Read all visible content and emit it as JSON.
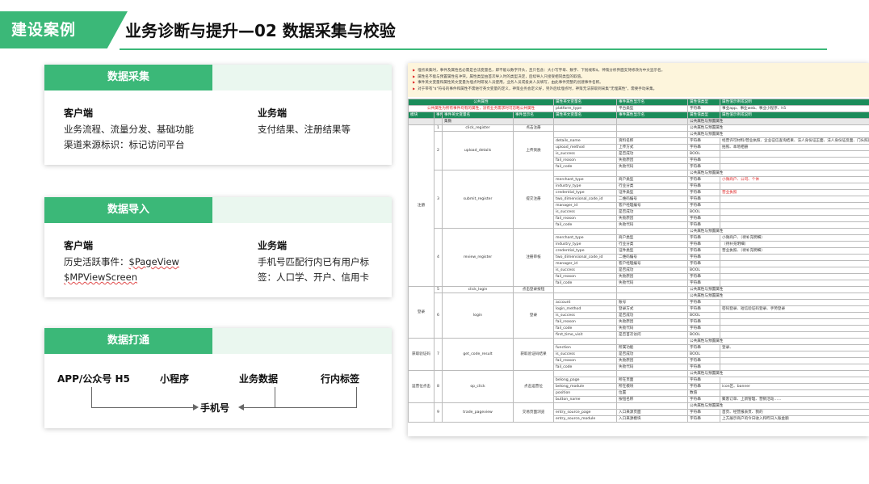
{
  "header": {
    "tag": "建设案例",
    "title": "业务诊断与提升—02 数据采集与校验"
  },
  "cards": {
    "collect": {
      "title": "数据采集",
      "left_title": "客户端",
      "left_lines": [
        "业务流程、流量分发、基础功能",
        "渠道来源标识：标记访问平台"
      ],
      "right_title": "业务端",
      "right_lines": [
        "支付结果、注册结果等"
      ]
    },
    "import": {
      "title": "数据导入",
      "left_title": "客户端",
      "left_line1_prefix": "历史活跃事件：",
      "left_line1_code": "$PageView",
      "left_line2_code": "$MPViewScreen",
      "right_title": "业务端",
      "right_lines": [
        "手机号匹配行内已有用户标",
        "签：人口学、开户、信用卡"
      ]
    },
    "connect": {
      "title": "数据打通",
      "items": [
        "APP/公众号 H5",
        "小程序",
        "业务数据",
        "行内标签"
      ],
      "target": "手机号"
    }
  },
  "sheet": {
    "notes": [
      "埋点采集时，事件及属性名必需是合法变量名，即不能以数字开头，且只包含：大小写字母、数字、下划线和$，神策分析界面支持修改为中文显示名。",
      "属性名不能与预置属性名冲突，属性类型由首次导入时的类型决定，后续导入只接受相同类型的取值。",
      "事件英文变量和属性英文变量为埋点时研发人员使用，业务人员或投关人员填写，由此事件完整的创建事件名称。",
      "对于带有\"$\"符号的事件和属性不需进行英文变量的定义，神策业务会定义好，另外后续埋点时，神策无法获取到采集\"无埋属性\"，需要手动采集。"
    ],
    "header1": [
      "公共属性",
      "属性英文变量名",
      "事件属性显示名",
      "属性值类型",
      "属性值示例或说明"
    ],
    "pub_note": "公共属性为所有事件均有的属性，没有业务需求时可忽略公共属性",
    "pub_row": [
      "platform_type",
      "平台类型",
      "字符串",
      "事业app、事业web、事业小程序、h5"
    ],
    "header2": [
      "模块",
      "事件",
      "事件英文变量名",
      "事件显示名",
      "属性英文变量名",
      "事件属性显示名",
      "属性值类型",
      "属性值示例或说明"
    ],
    "sub_header": "集数",
    "pub_label": "公共属性与预置属性",
    "rows": [
      {
        "m": "",
        "n": "1",
        "ev": "click_register",
        "evn": "点击注册",
        "props": []
      },
      {
        "m": "",
        "n": "2",
        "ev": "upload_details",
        "evn": "上传资质",
        "props": [
          [
            "details_name",
            "资料名称",
            "字符串",
            "经营许可材料/营业执照、企业征信查询结果、法人身份证正面、法人身份证反面、门头照片、门头合影、银行卡、备注图片"
          ],
          [
            "upload_method",
            "上传方式",
            "字符串",
            "拍照、本地相册"
          ],
          [
            "is_success",
            "是否成功",
            "BOOL",
            ""
          ],
          [
            "fail_reason",
            "失败原因",
            "字符串",
            ""
          ],
          [
            "fail_code",
            "失败代码",
            "字符串",
            ""
          ]
        ]
      },
      {
        "m": "注册",
        "n": "3",
        "ev": "submit_register",
        "evn": "提交注册",
        "props": [
          [
            "merchant_type",
            "商户类型",
            "字符串",
            "小微商户、公司、个体"
          ],
          [
            "industry_type",
            "行业分类",
            "字符串",
            ""
          ],
          [
            "credential_type",
            "证件类型",
            "字符串",
            "营业执照"
          ],
          [
            "two_dimensional_code_id",
            "二维码编号",
            "字符串",
            ""
          ],
          [
            "manager_id",
            "客户经理编号",
            "字符串",
            ""
          ],
          [
            "is_success",
            "是否成功",
            "BOOL",
            ""
          ],
          [
            "fail_reason",
            "失败原因",
            "字符串",
            ""
          ],
          [
            "fail_code",
            "失败代码",
            "字符串",
            ""
          ]
        ]
      },
      {
        "m": "",
        "n": "4",
        "ev": "review_register",
        "evn": "注册审核",
        "props": [
          [
            "merchant_type",
            "商户类型",
            "字符串",
            "小微商户、（待补充明细）"
          ],
          [
            "industry_type",
            "行业分类",
            "字符串",
            "（待补充明细）"
          ],
          [
            "credential_type",
            "证件类型",
            "字符串",
            "营业执照、（待补充明细）"
          ],
          [
            "two_dimensional_code_id",
            "二维码编号",
            "字符串",
            ""
          ],
          [
            "manager_id",
            "客户经理编号",
            "字符串",
            ""
          ],
          [
            "is_success",
            "是否成功",
            "BOOL",
            ""
          ],
          [
            "fail_reason",
            "失败原因",
            "字符串",
            ""
          ],
          [
            "fail_code",
            "失败代码",
            "字符串",
            ""
          ]
        ]
      },
      {
        "m": "",
        "n": "5",
        "ev": "click_login",
        "evn": "点击登录按钮",
        "props": []
      },
      {
        "m": "登录",
        "n": "6",
        "ev": "login",
        "evn": "登录",
        "props": [
          [
            "account",
            "账号",
            "字符串",
            ""
          ],
          [
            "login_method",
            "登录方式",
            "字符串",
            "密码登录、短信验证码登录、手势登录"
          ],
          [
            "is_success",
            "是否成功",
            "BOOL",
            ""
          ],
          [
            "fail_reason",
            "失败原因",
            "字符串",
            ""
          ],
          [
            "fail_code",
            "失败代码",
            "字符串",
            ""
          ],
          [
            "first_time_visit",
            "是否首次访问",
            "BOOL",
            ""
          ]
        ]
      },
      {
        "m": "获取验证码",
        "n": "7",
        "ev": "get_code_result",
        "evn": "获取验证码结果",
        "props": [
          [
            "function",
            "所属功能",
            "字符串",
            "登录、"
          ],
          [
            "is_success",
            "是否成功",
            "BOOL",
            ""
          ],
          [
            "fail_reason",
            "失败原因",
            "字符串",
            ""
          ],
          [
            "fail_code",
            "失败代码",
            "字符串",
            ""
          ]
        ]
      },
      {
        "m": "运营位点击",
        "n": "8",
        "ev": "op_click",
        "evn": "点击运营位",
        "props": [
          [
            "belong_page",
            "所在页面",
            "字符串",
            ""
          ],
          [
            "belong_module",
            "所在模块",
            "字符串",
            "icon区、banner"
          ],
          [
            "position",
            "位置",
            "数值",
            ""
          ],
          [
            "button_name",
            "按钮名称",
            "字符串",
            "聚客订单、上新管理、营销活动……"
          ]
        ]
      },
      {
        "m": "",
        "n": "9",
        "ev": "trade_pageview",
        "evn": "交易页面浏览",
        "props": [
          [
            "entry_source_page",
            "入口来源页面",
            "字符串",
            "首页、经营报表页、我的"
          ],
          [
            "entry_source_module",
            "入口来源模块",
            "字符串",
            "上方展示商户的今日收入和昨日入账金额"
          ]
        ]
      }
    ]
  }
}
